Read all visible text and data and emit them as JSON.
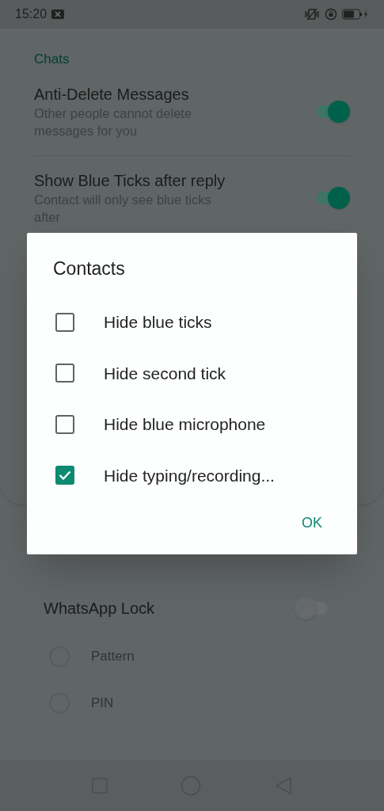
{
  "status_bar": {
    "time": "15:20"
  },
  "section": {
    "title": "Chats"
  },
  "settings": [
    {
      "title": "Anti-Delete Messages",
      "subtitle": "Other people cannot delete messages for you",
      "on": true
    },
    {
      "title": "Show Blue Ticks after reply",
      "subtitle": "Contact will only see blue ticks after",
      "on": true
    }
  ],
  "security": {
    "lock": {
      "title": "WhatsApp Lock",
      "on": false
    },
    "options": [
      {
        "label": "Pattern",
        "selected": false
      },
      {
        "label": "PIN",
        "selected": false
      }
    ]
  },
  "dialog": {
    "title": "Contacts",
    "options": [
      {
        "label": "Hide blue ticks",
        "checked": false
      },
      {
        "label": "Hide second tick",
        "checked": false
      },
      {
        "label": "Hide blue microphone",
        "checked": false
      },
      {
        "label": "Hide typing/recording...",
        "checked": true
      }
    ],
    "button": "OK"
  }
}
